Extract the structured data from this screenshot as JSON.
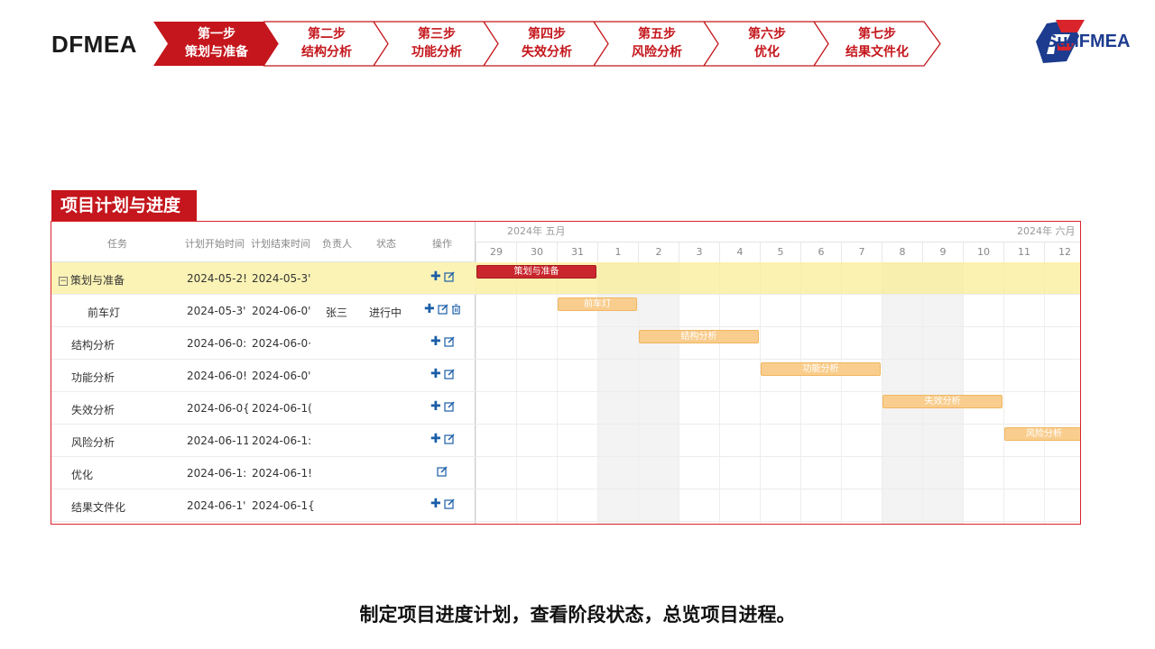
{
  "brand": "DFMEA",
  "steps": [
    {
      "line1": "第一步",
      "line2": "策划与准备",
      "active": true
    },
    {
      "line1": "第二步",
      "line2": "结构分析",
      "active": false
    },
    {
      "line1": "第三步",
      "line2": "功能分析",
      "active": false
    },
    {
      "line1": "第四步",
      "line2": "失效分析",
      "active": false
    },
    {
      "line1": "第五步",
      "line2": "风险分析",
      "active": false
    },
    {
      "line1": "第六步",
      "line2": "优化",
      "active": false
    },
    {
      "line1": "第七步",
      "line2": "结果文件化",
      "active": false
    }
  ],
  "logo": {
    "text": "SunFMEA"
  },
  "section_title": "项目计划与进度",
  "gantt": {
    "columns": [
      "任务",
      "计划开始时间",
      "计划结束时间",
      "负责人",
      "状态",
      "操作"
    ],
    "months": [
      "2024年 五月",
      "2024年 六月"
    ],
    "days": [
      "29",
      "30",
      "31",
      "1",
      "2",
      "3",
      "4",
      "5",
      "6",
      "7",
      "8",
      "9",
      "10",
      "11",
      "12"
    ],
    "rows": [
      {
        "task": "策划与准备",
        "start": "2024-05-2!",
        "end": "2024-05-3'",
        "owner": "",
        "status": "",
        "ops": "add,edit",
        "parent": true,
        "bar_label": "策划与准备"
      },
      {
        "task": "前车灯",
        "start": "2024-05-3'",
        "end": "2024-06-0'",
        "owner": "张三",
        "status": "进行中",
        "ops": "add,edit,delete",
        "parent": false,
        "bar_label": "前车灯"
      },
      {
        "task": "结构分析",
        "start": "2024-06-0:",
        "end": "2024-06-0·",
        "owner": "",
        "status": "",
        "ops": "add,edit",
        "parent": false,
        "bar_label": "结构分析"
      },
      {
        "task": "功能分析",
        "start": "2024-06-0!",
        "end": "2024-06-0'",
        "owner": "",
        "status": "",
        "ops": "add,edit",
        "parent": false,
        "bar_label": "功能分析"
      },
      {
        "task": "失效分析",
        "start": "2024-06-0{",
        "end": "2024-06-1(",
        "owner": "",
        "status": "",
        "ops": "add,edit",
        "parent": false,
        "bar_label": "失效分析"
      },
      {
        "task": "风险分析",
        "start": "2024-06-11",
        "end": "2024-06-1:",
        "owner": "",
        "status": "",
        "ops": "add,edit",
        "parent": false,
        "bar_label": "风险分析"
      },
      {
        "task": "优化",
        "start": "2024-06-1:",
        "end": "2024-06-1!",
        "owner": "",
        "status": "",
        "ops": "edit",
        "parent": false,
        "bar_label": ""
      },
      {
        "task": "结果文件化",
        "start": "2024-06-1'",
        "end": "2024-06-1{",
        "owner": "",
        "status": "",
        "ops": "add,edit",
        "parent": false,
        "bar_label": ""
      }
    ]
  },
  "caption": "制定项目进度计划，查看阶段状态，总览项目进程。",
  "colors": {
    "accent": "#c4161c",
    "highlight": "#fbf3b5",
    "bar_child": "#f9cd8d",
    "icon": "#1a5ea8",
    "logo_blue": "#1d3c8f"
  }
}
